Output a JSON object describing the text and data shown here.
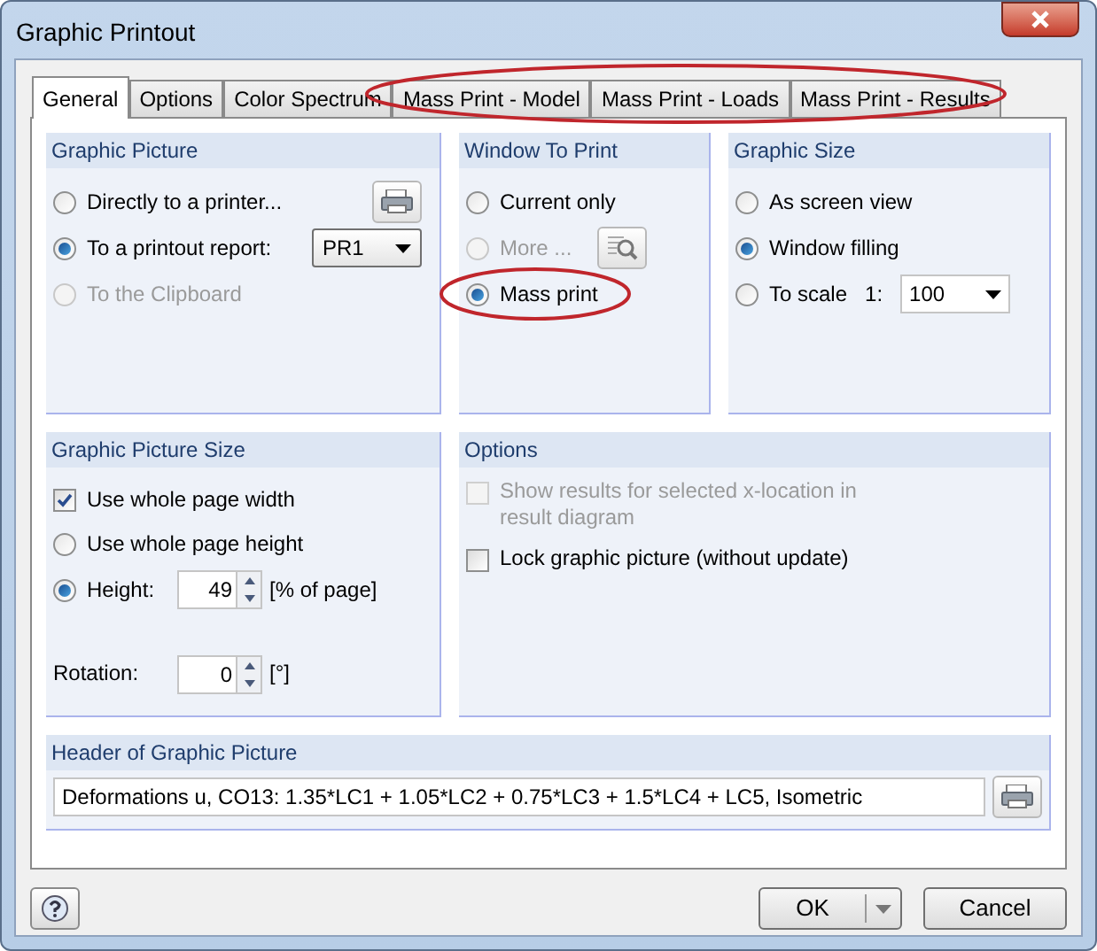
{
  "window": {
    "title": "Graphic Printout"
  },
  "tabs": [
    {
      "label": "General",
      "selected": true
    },
    {
      "label": "Options",
      "selected": false
    },
    {
      "label": "Color Spectrum",
      "selected": false
    },
    {
      "label": "Mass Print - Model",
      "selected": false
    },
    {
      "label": "Mass Print - Loads",
      "selected": false
    },
    {
      "label": "Mass Print - Results",
      "selected": false
    }
  ],
  "graphic_picture": {
    "title": "Graphic Picture",
    "options": [
      {
        "label": "Directly to a printer...",
        "selected": false,
        "disabled": false
      },
      {
        "label": "To a printout report:",
        "selected": true,
        "disabled": false
      },
      {
        "label": "To the Clipboard",
        "selected": false,
        "disabled": true
      }
    ],
    "report": "PR1"
  },
  "window_to_print": {
    "title": "Window To Print",
    "options": [
      {
        "label": "Current only",
        "selected": false,
        "disabled": false
      },
      {
        "label": "More ...",
        "selected": false,
        "disabled": true
      },
      {
        "label": "Mass print",
        "selected": true,
        "disabled": false
      }
    ]
  },
  "graphic_size": {
    "title": "Graphic Size",
    "options": [
      {
        "label": "As screen view",
        "selected": false
      },
      {
        "label": "Window filling",
        "selected": true
      },
      {
        "label": "To scale",
        "selected": false
      }
    ],
    "scale_label": "1:",
    "scale_value": "100"
  },
  "picture_size": {
    "title": "Graphic Picture Size",
    "use_width": {
      "label": "Use whole page width",
      "checked": true
    },
    "options": [
      {
        "label": "Use whole page height",
        "selected": false
      },
      {
        "label": "Height:",
        "selected": true
      }
    ],
    "height_value": "49",
    "height_unit": "[% of page]",
    "rotation_label": "Rotation:",
    "rotation_value": "0",
    "rotation_unit": "[°]"
  },
  "options": {
    "title": "Options",
    "items": [
      {
        "label": "Show results for selected x-location in result diagram",
        "checked": false,
        "disabled": true
      },
      {
        "label": "Lock graphic picture (without update)",
        "checked": false,
        "disabled": false
      }
    ]
  },
  "header": {
    "title": "Header of Graphic Picture",
    "value": "Deformations u, CO13: 1.35*LC1 + 1.05*LC2 + 0.75*LC3 + 1.5*LC4 + LC5, Isometric"
  },
  "buttons": {
    "ok": "OK",
    "cancel": "Cancel"
  }
}
